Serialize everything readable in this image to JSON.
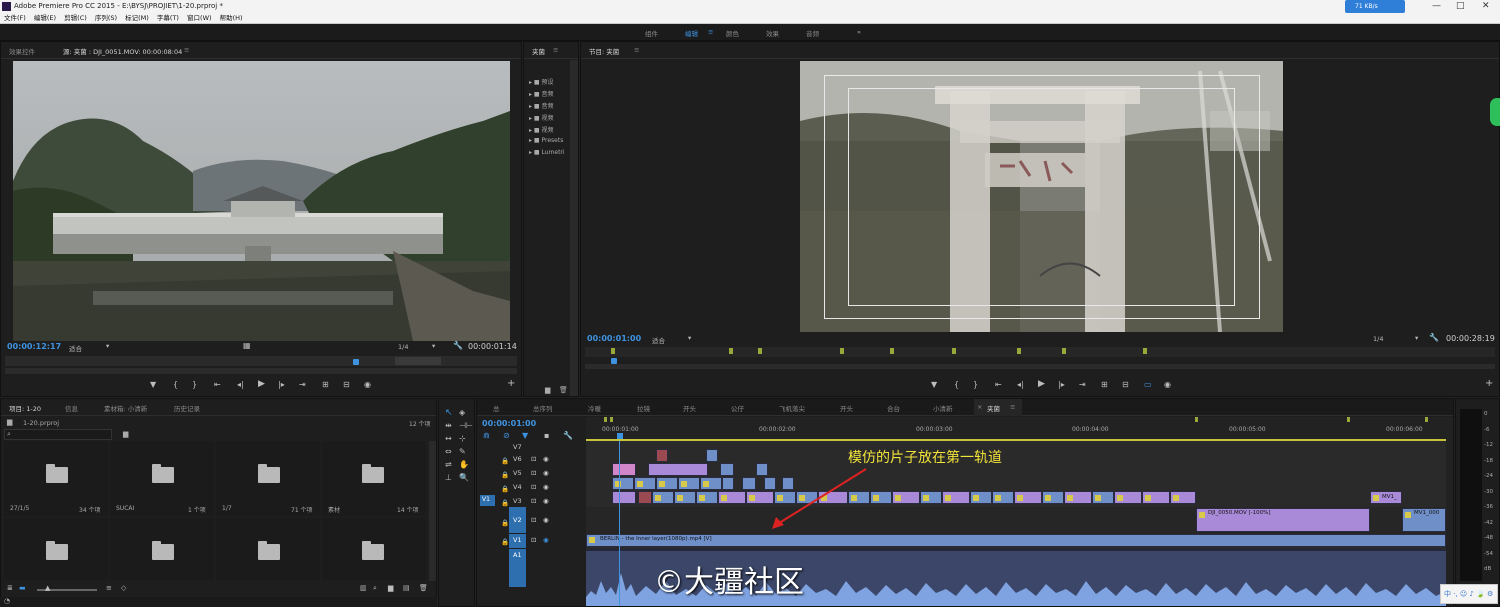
{
  "titlebar": {
    "title": "Adobe Premiere Pro CC 2015 - E:\\BYSJ\\PROJIET\\1-20.prproj *",
    "net_speed": "71 KB/s",
    "minimize": "—",
    "maximize": "□",
    "close": "✕"
  },
  "menu": [
    "文件(F)",
    "编辑(E)",
    "剪辑(C)",
    "序列(S)",
    "标记(M)",
    "字幕(T)",
    "窗口(W)",
    "帮助(H)"
  ],
  "workspaces": [
    "组件",
    "编辑",
    "颜色",
    "效果",
    "音频"
  ],
  "workspace_active": 1,
  "source_monitor": {
    "tabs": [
      "效果控件",
      "源: 夹菌 : DJI_0051.MOV: 00:00:08:04"
    ],
    "timecode_in": "00:00:12:17",
    "fit": "适合",
    "res": "1/4",
    "duration": "00:00:01:14"
  },
  "media_bin": {
    "tab": "夹菌",
    "items": [
      "预设",
      "音频",
      "音频",
      "视频",
      "视频",
      "Presets",
      "Lumetri"
    ]
  },
  "program_monitor": {
    "tab": "节目: 夹菌",
    "timecode": "00:00:01:00",
    "fit": "适合",
    "res": "1/4",
    "duration": "00:00:28:19"
  },
  "project": {
    "tabs": [
      "项目: 1-20",
      "信息",
      "素材箱: 小清新",
      "历史记录"
    ],
    "filename": "1-20.prproj",
    "count": "12 个项",
    "bins": [
      {
        "name": "27/1/5",
        "count": "34 个项"
      },
      {
        "name": "SUCAI",
        "count": "1 个项"
      },
      {
        "name": "1/7",
        "count": "71 个项"
      },
      {
        "name": "素材",
        "count": "14 个项"
      }
    ]
  },
  "timeline": {
    "tabs": [
      "总",
      "总序列",
      "冷暖",
      "拉镜",
      "开头",
      "公仔",
      "飞机落尖",
      "开头",
      "合台",
      "小清新",
      "夹菌"
    ],
    "active_tab": 10,
    "timecode": "00:00:01:00",
    "ruler_labels": [
      "00:00:01:00",
      "00:00:02:00",
      "00:00:03:00",
      "00:00:04:00",
      "00:00:05:00",
      "00:00:06:00"
    ],
    "tracks": [
      "V7",
      "V6",
      "V5",
      "V4",
      "V3",
      "V2",
      "V1",
      "A1"
    ],
    "clip_labels": {
      "v2_clip": "DJI_0050.MOV [-100%]",
      "v2_right": "MV1_000",
      "v3_right": "MV1_",
      "v1_clip": "BERLIN - the Inner layer(1080p).mp4 [V]"
    },
    "annotation": "模仿的片子放在第一轨道"
  },
  "meter": {
    "labels": [
      "0",
      "-6",
      "-12",
      "-18",
      "-24",
      "-30",
      "-36",
      "-42",
      "-48",
      "-54",
      "dB"
    ]
  },
  "watermark": "©大疆社区",
  "ime": "中 ·, ☺ ♪ 🍃 ⚙"
}
